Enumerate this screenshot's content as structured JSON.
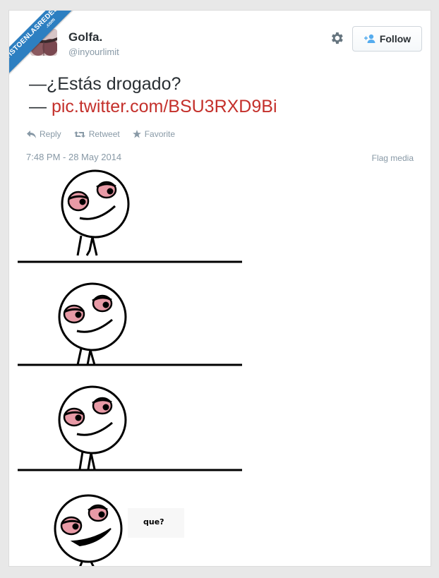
{
  "watermark": {
    "main": "VISTOENLASREDES",
    "sub": ".com"
  },
  "user": {
    "name": "Golfa.",
    "handle": "@inyourlimit"
  },
  "header": {
    "follow_label": "Follow"
  },
  "tweet": {
    "line1": "—¿Estás drogado?",
    "line2_prefix": "— ",
    "link": "pic.twitter.com/BSU3RXD9Bi",
    "link_color": "#c4302b"
  },
  "actions": {
    "reply": "Reply",
    "retweet": "Retweet",
    "favorite": "Favorite"
  },
  "timestamp": "7:48 PM - 28 May 2014",
  "flag_media": "Flag media",
  "media": {
    "speech_bubble": "que?"
  },
  "colors": {
    "accent": "#2d7fc1",
    "muted": "#8899a6",
    "text": "#292f33",
    "eye_pink": "#e89aa6"
  }
}
